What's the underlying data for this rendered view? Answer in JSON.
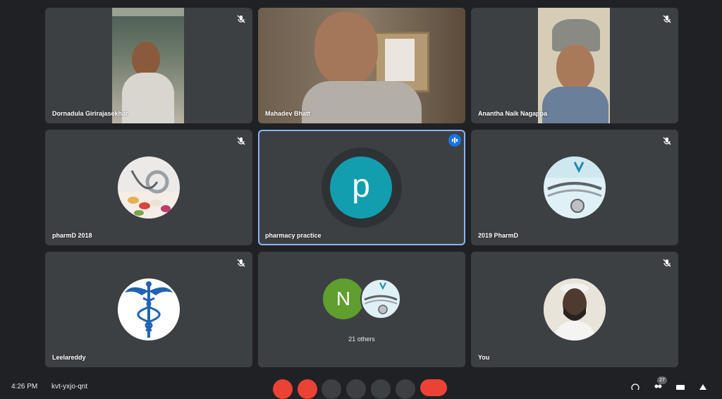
{
  "participants": [
    {
      "name": "Dornadula Girirajasekhar",
      "type": "video",
      "muted": true
    },
    {
      "name": "Mahadev Bhatt",
      "type": "video",
      "muted": false
    },
    {
      "name": "Anantha Naik Nagappa",
      "type": "video",
      "muted": true
    },
    {
      "name": "pharmD 2018",
      "type": "avatar-image",
      "avatar": "stethoscope-pills",
      "muted": true
    },
    {
      "name": "pharmacy practice",
      "type": "avatar-letter",
      "letter": "p",
      "color": "#129eaf",
      "speaking": true
    },
    {
      "name": "2019 PharmD",
      "type": "avatar-image",
      "avatar": "stethoscope",
      "muted": true
    },
    {
      "name": "Leelareddy",
      "type": "avatar-image",
      "avatar": "caduceus",
      "muted": true
    },
    {
      "group": true,
      "letter": "N",
      "letter_color": "#5f9e2f",
      "label": "21 others"
    },
    {
      "name": "You",
      "type": "avatar-image",
      "avatar": "self-photo",
      "muted": true
    }
  ],
  "bottom_bar": {
    "clock": "4:26 PM",
    "meeting_code": "kvt-yxjo-qnt",
    "people_count": "27"
  },
  "colors": {
    "background": "#202124",
    "tile": "#3c4043",
    "accent": "#8ab4f8",
    "end_call": "#ea4335"
  }
}
